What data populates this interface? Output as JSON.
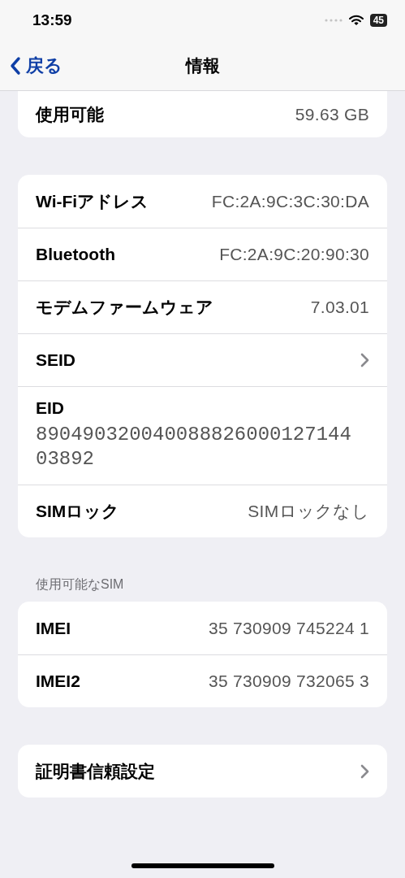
{
  "status_bar": {
    "time": "13:59",
    "battery": "45"
  },
  "nav": {
    "back": "戻る",
    "title": "情報"
  },
  "sections": [
    {
      "clipped_top": true,
      "rows": [
        {
          "kind": "value",
          "label": "使用可能",
          "value": "59.63 GB"
        }
      ]
    },
    {
      "rows": [
        {
          "kind": "value",
          "label": "Wi-Fiアドレス",
          "value": "FC:2A:9C:3C:30:DA"
        },
        {
          "kind": "value",
          "label": "Bluetooth",
          "value": "FC:2A:9C:20:90:30"
        },
        {
          "kind": "value",
          "label": "モデムファームウェア",
          "value": "7.03.01"
        },
        {
          "kind": "chevron",
          "label": "SEID"
        },
        {
          "kind": "stacked",
          "label": "EID",
          "value": "89049032004008882600012714403892"
        },
        {
          "kind": "value",
          "label": "SIMロック",
          "value": "SIMロックなし"
        }
      ]
    },
    {
      "header": "使用可能なSIM",
      "rows": [
        {
          "kind": "value",
          "label": "IMEI",
          "value": "35 730909 745224 1"
        },
        {
          "kind": "value",
          "label": "IMEI2",
          "value": "35 730909 732065 3"
        }
      ]
    },
    {
      "rows": [
        {
          "kind": "chevron",
          "label": "証明書信頼設定"
        }
      ]
    }
  ]
}
